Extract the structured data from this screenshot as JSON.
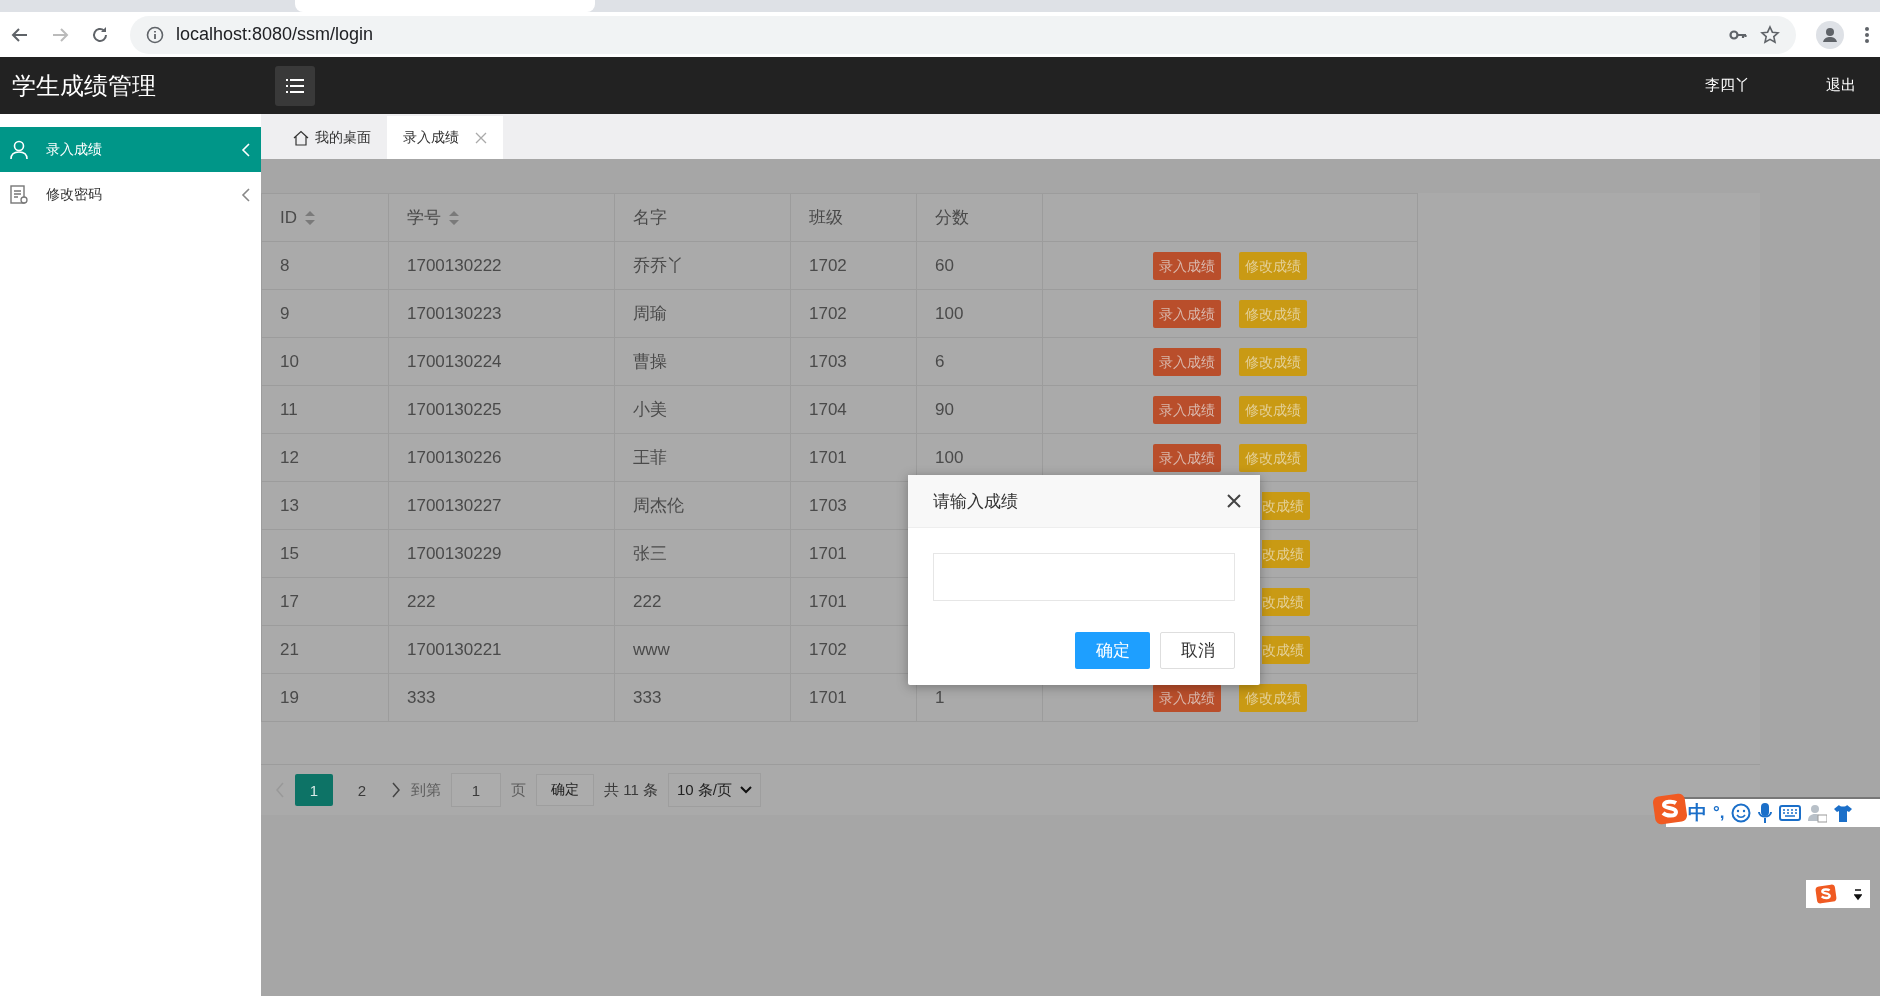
{
  "browser": {
    "url": "localhost:8080/ssm/login"
  },
  "header": {
    "title": "学生成绩管理",
    "user": "李四丫",
    "logout": "退出"
  },
  "sidebar": {
    "items": [
      {
        "label": "录入成绩",
        "kind": "user",
        "selected": true
      },
      {
        "label": "修改密码",
        "kind": "document",
        "selected": false
      }
    ]
  },
  "tabs": [
    {
      "label": "我的桌面",
      "kind": "home",
      "selected": false
    },
    {
      "label": "录入成绩",
      "kind": "closable",
      "selected": true
    }
  ],
  "table": {
    "columns": [
      {
        "label": "ID",
        "sortable": true
      },
      {
        "label": "学号",
        "sortable": true
      },
      {
        "label": "名字",
        "sortable": false
      },
      {
        "label": "班级",
        "sortable": false
      },
      {
        "label": "分数",
        "sortable": false
      }
    ],
    "rows": [
      {
        "cells": [
          "8",
          "1700130222",
          "乔乔丫",
          "1702",
          "60"
        ],
        "actions": [
          "录入成绩",
          "修改成绩"
        ]
      },
      {
        "cells": [
          "9",
          "1700130223",
          "周瑜",
          "1702",
          "100"
        ],
        "actions": [
          "录入成绩",
          "修改成绩"
        ]
      },
      {
        "cells": [
          "10",
          "1700130224",
          "曹操",
          "1703",
          "6"
        ],
        "actions": [
          "录入成绩",
          "修改成绩"
        ]
      },
      {
        "cells": [
          "11",
          "1700130225",
          "小美",
          "1704",
          "90"
        ],
        "actions": [
          "录入成绩",
          "修改成绩"
        ]
      },
      {
        "cells": [
          "12",
          "1700130226",
          "王菲",
          "1701",
          "100"
        ],
        "actions": [
          "录入成绩",
          "修改成绩"
        ]
      },
      {
        "cells": [
          "13",
          "1700130227",
          "周杰伦",
          "1703",
          ""
        ],
        "actions": [
          "改成绩"
        ]
      },
      {
        "cells": [
          "15",
          "1700130229",
          "张三",
          "1701",
          ""
        ],
        "actions": [
          "改成绩"
        ]
      },
      {
        "cells": [
          "17",
          "222",
          "222",
          "1701",
          ""
        ],
        "actions": [
          "改成绩"
        ]
      },
      {
        "cells": [
          "21",
          "1700130221",
          "www",
          "1702",
          ""
        ],
        "actions": [
          "改成绩"
        ]
      },
      {
        "cells": [
          "19",
          "333",
          "333",
          "1701",
          "1"
        ],
        "actions": [
          "录入成绩",
          "修改成绩"
        ]
      }
    ]
  },
  "pagination": {
    "pages": [
      {
        "label": "1",
        "selected": true
      },
      {
        "label": "2",
        "selected": false
      }
    ],
    "goto_label": "到第",
    "page_value": "1",
    "page_unit": "页",
    "confirm": "确定",
    "total": "共 11 条",
    "page_size": "10 条/页"
  },
  "dialog": {
    "title": "请输入成绩",
    "ok": "确定",
    "cancel": "取消"
  },
  "ime": {
    "mode": "中",
    "punctuation": "°,"
  }
}
